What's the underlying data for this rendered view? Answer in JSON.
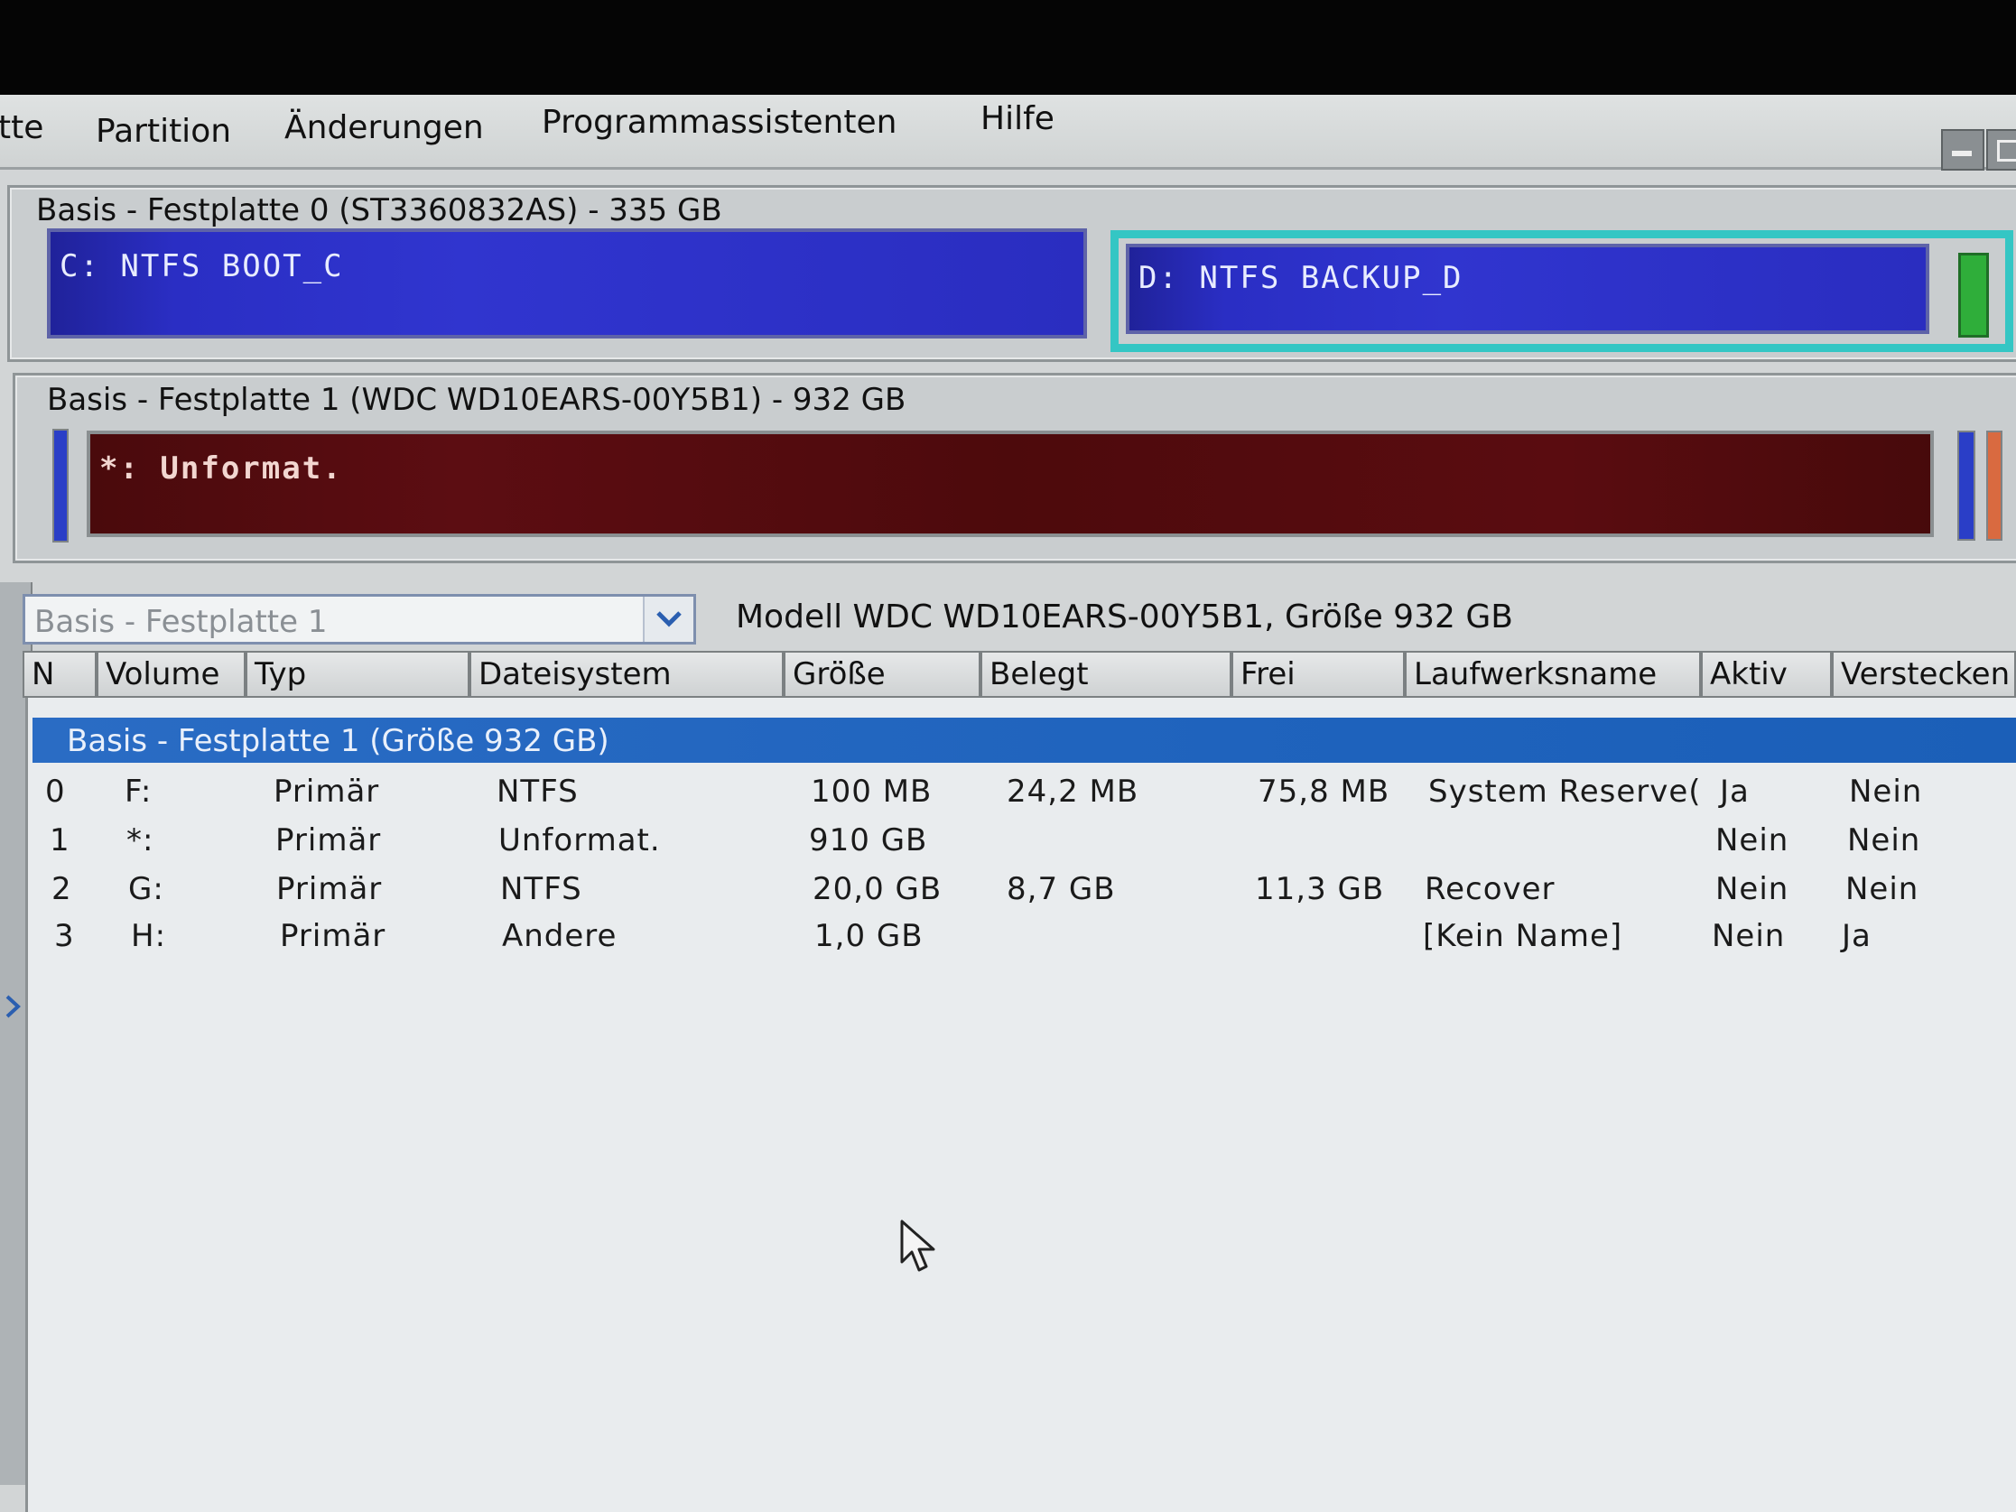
{
  "menu": {
    "items": [
      "tte",
      "Partition",
      "Änderungen",
      "Programmassistenten",
      "Hilfe"
    ]
  },
  "disks": [
    {
      "title": "Basis -  Festplatte 0 (ST3360832AS) - 335 GB",
      "partitions": [
        {
          "label": "C: NTFS BOOT_C"
        },
        {
          "label": "D: NTFS BACKUP_D"
        }
      ]
    },
    {
      "title": "Basis -  Festplatte 1 (WDC WD10EARS-00Y5B1) - 932 GB",
      "partitions": [
        {
          "label": "*: Unformat."
        }
      ]
    }
  ],
  "disk_selector": {
    "value": "Basis -  Festplatte 1",
    "model_info": "Modell WDC WD10EARS-00Y5B1, Größe 932 GB"
  },
  "table": {
    "columns": [
      "N",
      "Volume",
      "Typ",
      "Dateisystem",
      "Größe",
      "Belegt",
      "Frei",
      "Laufwerksname",
      "Aktiv",
      "Verstecken"
    ],
    "group_label": "Basis -  Festplatte 1 (Größe 932 GB)",
    "rows": [
      [
        "0",
        "F:",
        "Primär",
        "NTFS",
        "100 MB",
        "24,2 MB",
        "75,8 MB",
        "System Reserve(",
        "Ja",
        "Nein"
      ],
      [
        "1",
        "*:",
        "Primär",
        "Unformat.",
        "910 GB",
        "",
        "",
        "",
        "Nein",
        "Nein"
      ],
      [
        "2",
        "G:",
        "Primär",
        "NTFS",
        "20,0 GB",
        "8,7 GB",
        "11,3 GB",
        "Recover",
        "Nein",
        "Nein"
      ],
      [
        "3",
        "H:",
        "Primär",
        "Andere",
        "1,0 GB",
        "",
        "",
        "[Kein Name]",
        "Nein",
        "Ja"
      ]
    ]
  },
  "colors": {
    "ntfs_partition": "#2a2ec4",
    "unformatted_partition": "#5c0d12",
    "selection_border": "#34c6c4",
    "group_row": "#1f63bd"
  },
  "icons": [
    "chevron-down-icon",
    "minimize-icon",
    "restore-icon",
    "mouse-cursor-icon",
    "expand-arrow-icon"
  ]
}
